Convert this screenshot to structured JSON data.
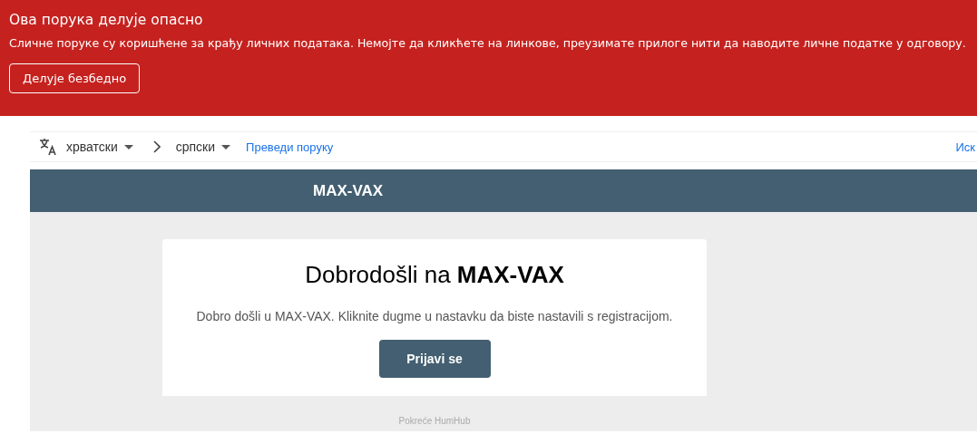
{
  "warning": {
    "title": "Ова порука делује опасно",
    "message": "Сличне поруке су коришћене за крађу личних података. Немојте да кликћете на линкове, преузимате прилоге нити да наводите личне податке у одговору.",
    "button": "Делује безбедно"
  },
  "translate_bar": {
    "source_language": "хрватски",
    "target_language": "српски",
    "translate_link": "Преведи поруку",
    "right_link": "Иск"
  },
  "email": {
    "header_title": "MAX-VAX",
    "heading": "Dobrodošli na **MAX-VAX**",
    "body": "Dobro došli u MAX-VAX. Kliknite dugme u nastavku da biste nastavili s registracijom.",
    "button": "Prijavi se",
    "footer": "Pokreće HumHub"
  }
}
